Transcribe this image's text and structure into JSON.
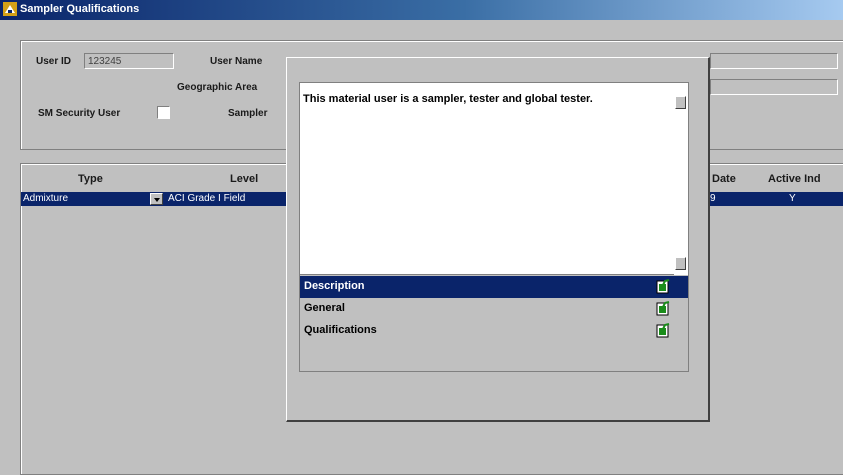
{
  "window": {
    "title": "Sampler Qualifications"
  },
  "header": {
    "user_id_label": "User ID",
    "user_id_value": "123245",
    "user_name_label": "User Name",
    "geo_area_label": "Geographic Area",
    "sm_security_label": "SM Security User",
    "sampler_label": "Sampler"
  },
  "grid": {
    "columns": [
      "Type",
      "Level",
      "Date",
      "Active Ind"
    ],
    "rows": [
      {
        "type": "Admixture",
        "level": "ACI Grade I Field",
        "date": "9",
        "active": "Y"
      }
    ]
  },
  "popup": {
    "description_text": "This material user is a sampler, tester and global tester.",
    "items": [
      {
        "label": "Description",
        "selected": true,
        "icon": "edit-check-icon"
      },
      {
        "label": "General",
        "selected": false,
        "icon": "edit-check-icon"
      },
      {
        "label": "Qualifications",
        "selected": false,
        "icon": "edit-check-icon"
      }
    ]
  },
  "colors": {
    "titlebar": "#0a246a",
    "selection": "#0a246a",
    "face": "#c0c0c0"
  }
}
